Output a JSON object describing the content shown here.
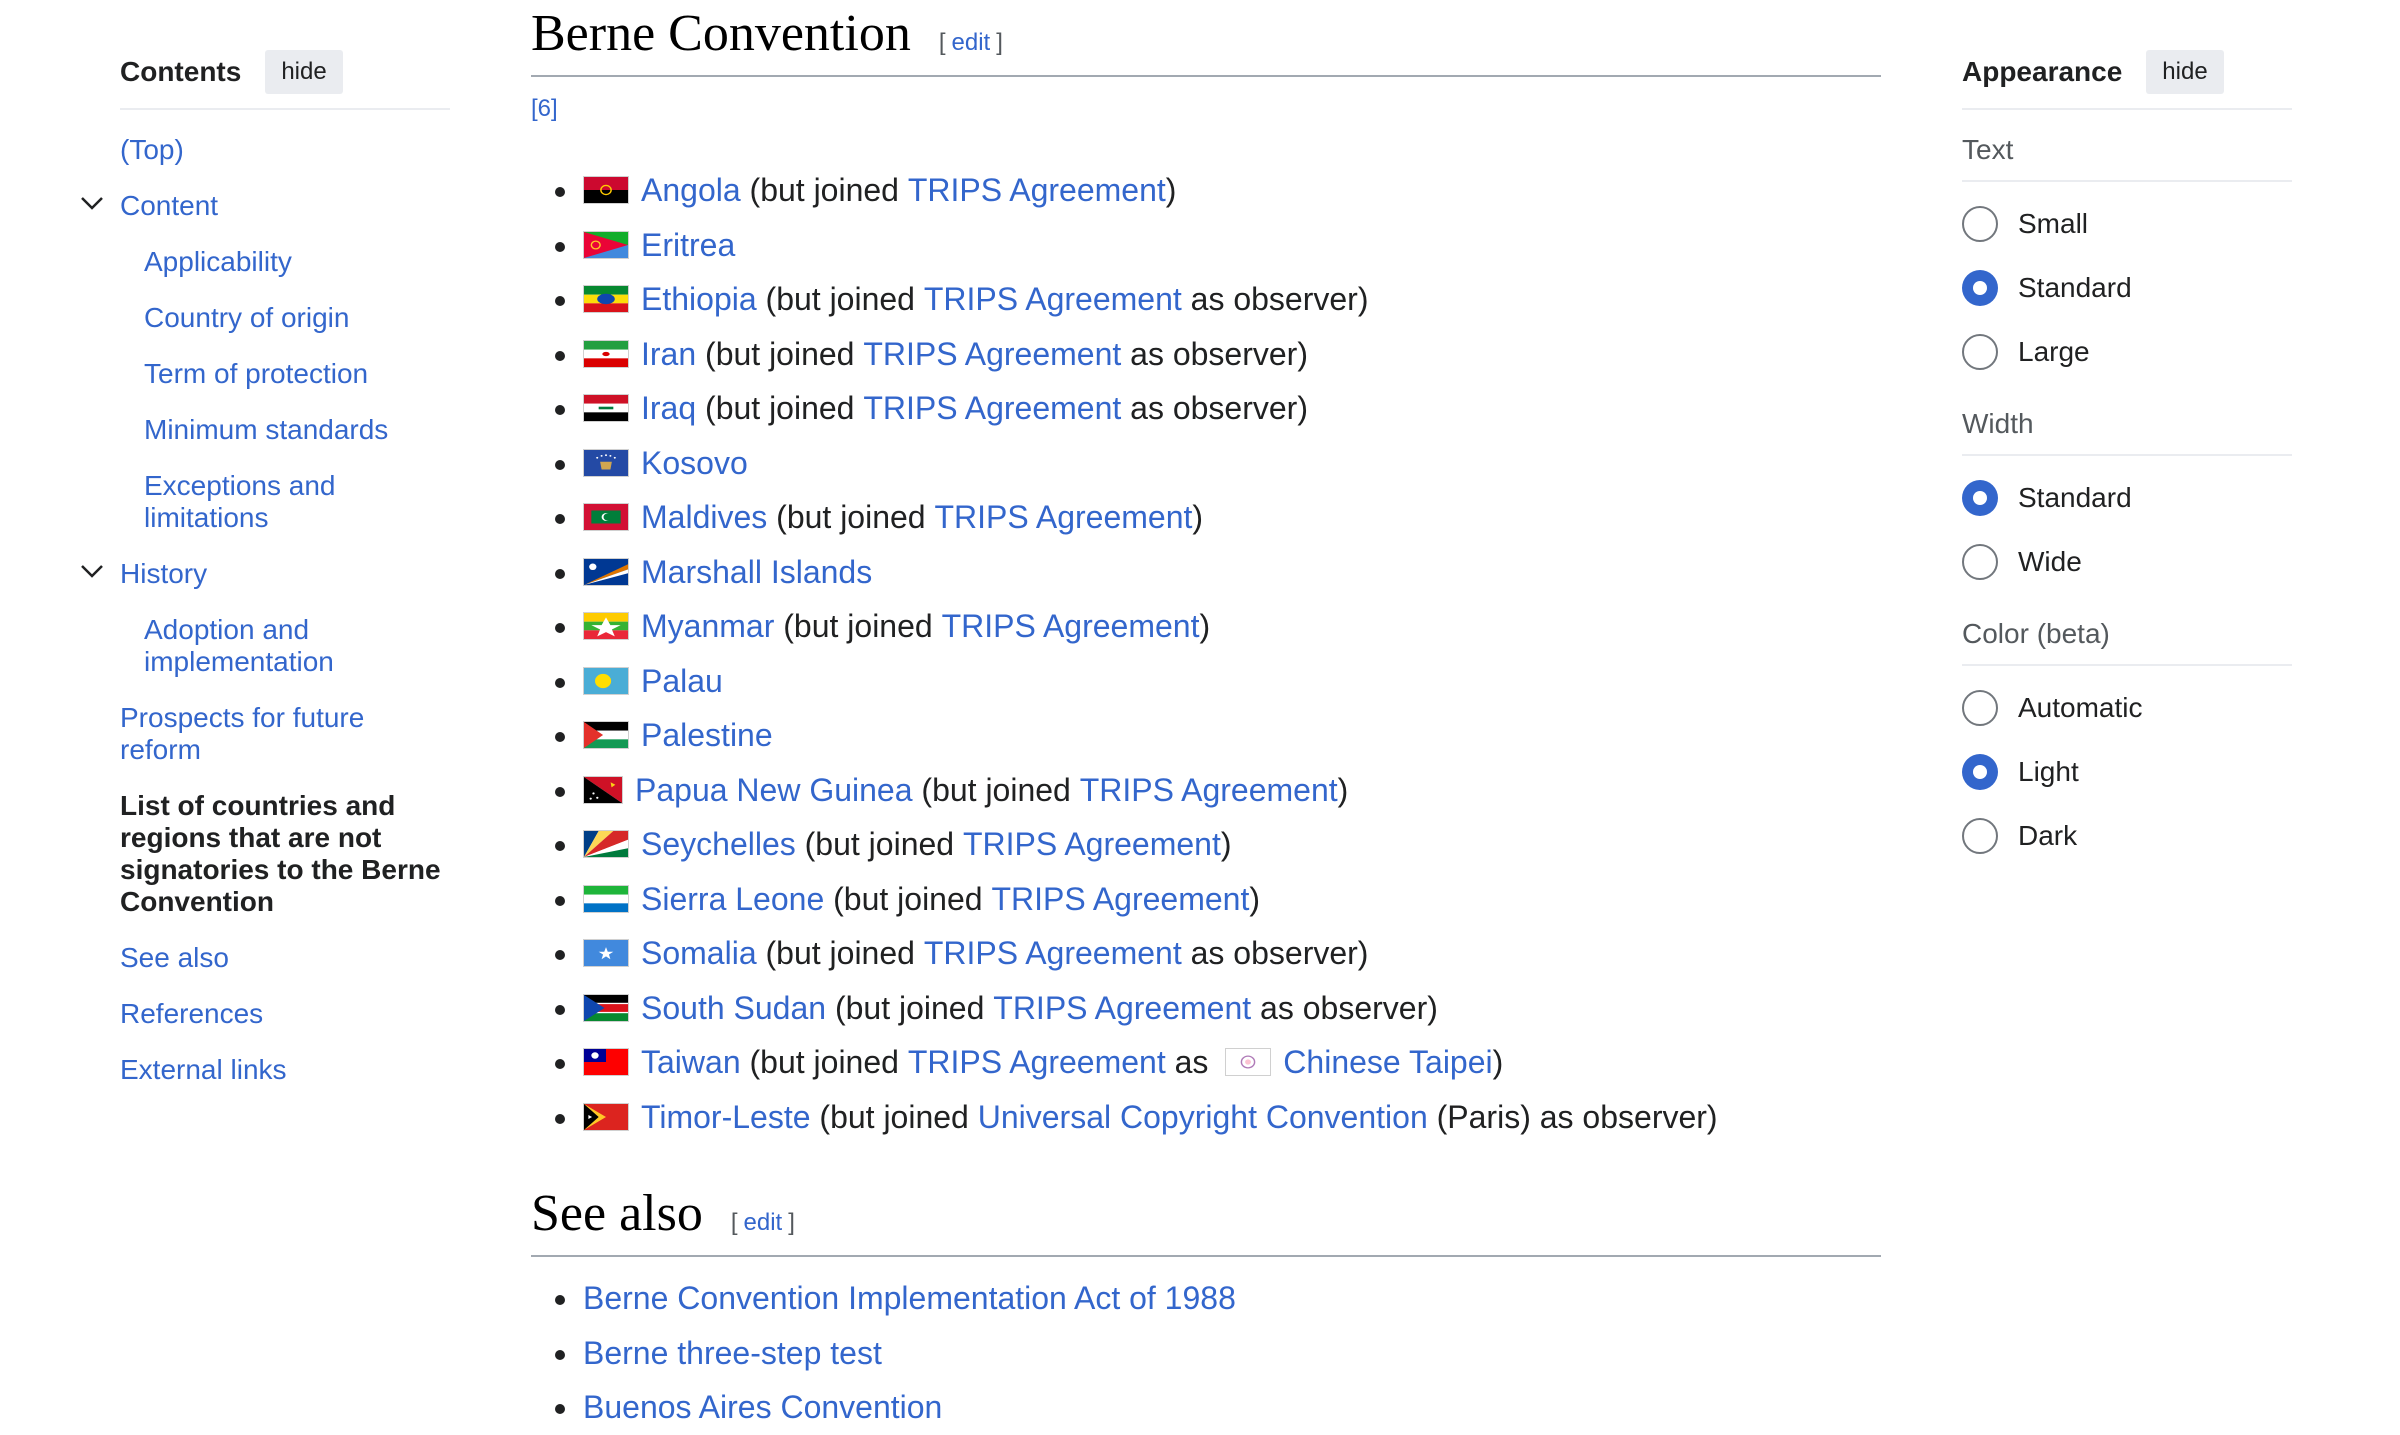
{
  "toc": {
    "title": "Contents",
    "hide": "hide",
    "items": [
      {
        "label": "(Top)"
      },
      {
        "label": "Content"
      },
      {
        "label": "Applicability"
      },
      {
        "label": "Country of origin"
      },
      {
        "label": "Term of protection"
      },
      {
        "label": "Minimum standards"
      },
      {
        "label": "Exceptions and limitations"
      },
      {
        "label": "History"
      },
      {
        "label": "Adoption and implementation"
      },
      {
        "label": "Prospects for future reform"
      },
      {
        "label": "List of countries and regions that are not signatories to the Berne Convention"
      },
      {
        "label": "See also"
      },
      {
        "label": "References"
      },
      {
        "label": "External links"
      }
    ]
  },
  "main": {
    "heading": "Berne Convention",
    "edit_label": "edit",
    "edit_open": "[",
    "edit_close": "]",
    "citation": "[6]",
    "countries": [
      {
        "name": "Angola",
        "pre": " (but joined ",
        "link2": "TRIPS Agreement",
        "post": ")"
      },
      {
        "name": "Eritrea",
        "pre": "",
        "link2": "",
        "post": ""
      },
      {
        "name": "Ethiopia",
        "pre": " (but joined ",
        "link2": "TRIPS Agreement",
        "post": " as observer)"
      },
      {
        "name": "Iran",
        "pre": " (but joined ",
        "link2": "TRIPS Agreement",
        "post": " as observer)"
      },
      {
        "name": "Iraq",
        "pre": " (but joined ",
        "link2": "TRIPS Agreement",
        "post": " as observer)"
      },
      {
        "name": "Kosovo",
        "pre": "",
        "link2": "",
        "post": ""
      },
      {
        "name": "Maldives",
        "pre": " (but joined ",
        "link2": "TRIPS Agreement",
        "post": ")"
      },
      {
        "name": "Marshall Islands",
        "pre": "",
        "link2": "",
        "post": ""
      },
      {
        "name": "Myanmar",
        "pre": " (but joined ",
        "link2": "TRIPS Agreement",
        "post": ")"
      },
      {
        "name": "Palau",
        "pre": "",
        "link2": "",
        "post": ""
      },
      {
        "name": "Palestine",
        "pre": "",
        "link2": "",
        "post": ""
      },
      {
        "name": "Papua New Guinea",
        "pre": " (but joined ",
        "link2": "TRIPS Agreement",
        "post": ")"
      },
      {
        "name": "Seychelles",
        "pre": " (but joined ",
        "link2": "TRIPS Agreement",
        "post": ")"
      },
      {
        "name": "Sierra Leone",
        "pre": " (but joined ",
        "link2": "TRIPS Agreement",
        "post": ")"
      },
      {
        "name": "Somalia",
        "pre": " (but joined ",
        "link2": "TRIPS Agreement",
        "post": " as observer)"
      },
      {
        "name": "South Sudan",
        "pre": " (but joined ",
        "link2": "TRIPS Agreement",
        "post": " as observer)"
      },
      {
        "name": "Taiwan",
        "pre": " (but joined ",
        "link2": "TRIPS Agreement",
        "mid": " as ",
        "link3": "Chinese Taipei",
        "post": ")"
      },
      {
        "name": "Timor-Leste",
        "pre": " (but joined ",
        "link2": "Universal Copyright Convention",
        "post": " (Paris) as observer)"
      }
    ],
    "see_also_heading": "See also",
    "see_also": [
      "Berne Convention Implementation Act of 1988",
      "Berne three-step test",
      "Buenos Aires Convention"
    ]
  },
  "appearance": {
    "title": "Appearance",
    "hide": "hide",
    "text_label": "Text",
    "text_options": [
      "Small",
      "Standard",
      "Large"
    ],
    "text_selected": "Standard",
    "width_label": "Width",
    "width_options": [
      "Standard",
      "Wide"
    ],
    "width_selected": "Standard",
    "color_label": "Color (beta)",
    "color_options": [
      "Automatic",
      "Light",
      "Dark"
    ],
    "color_selected": "Light"
  },
  "colors": {
    "link": "#3366cc",
    "text": "#202122",
    "radio_selected": "#3366cc"
  }
}
